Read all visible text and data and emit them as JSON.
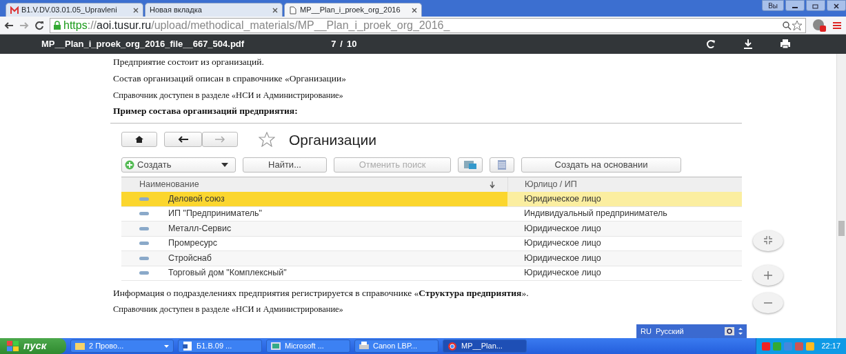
{
  "browser": {
    "tabs": [
      {
        "title": "B1.V.DV.03.01.05_Upravleni",
        "kind": "mail",
        "selected": false
      },
      {
        "title": "Новая вкладка",
        "kind": "blank",
        "selected": false
      },
      {
        "title": "MP__Plan_i_proek_org_2016",
        "kind": "doc",
        "selected": true
      }
    ],
    "user_button": "Вы",
    "address": {
      "scheme": "https",
      "separator": "://",
      "host": "aoi.tusur.ru",
      "path": "/upload/methodical_materials/MP__Plan_i_proek_org_2016_"
    }
  },
  "pdf_toolbar": {
    "file_name": "MP__Plan_i_proek_org_2016_file__667_504.pdf",
    "page": "7",
    "page_separator": "/",
    "page_count": "10"
  },
  "document": {
    "paragraphs_before": [
      {
        "text": "Предприятие состоит из организаций.",
        "kind": "text"
      },
      {
        "text": "Состав организаций описан в справочнике «Организации»",
        "kind": "text"
      },
      {
        "text": "Справочник доступен в разделе «НСИ и Администрирование»",
        "kind": "small"
      },
      {
        "text": "Пример состава организаций предприятия:",
        "kind": "bold"
      }
    ],
    "figure": {
      "title": "Организации",
      "buttons": [
        {
          "label": "Создать",
          "kind": "create",
          "disabled": false
        },
        {
          "label": "Найти...",
          "kind": "plain",
          "disabled": false
        },
        {
          "label": "Отменить поиск",
          "kind": "plain",
          "disabled": true
        },
        {
          "label": "Создать на основании",
          "kind": "plain",
          "disabled": false
        }
      ],
      "columns": [
        "Наименование",
        "Юрлицо / ИП"
      ],
      "rows": [
        {
          "name": "Деловой союз",
          "type": "Юридическое лицо",
          "selected": true
        },
        {
          "name": "ИП \"Предприниматель\"",
          "type": "Индивидуальный предприниматель",
          "selected": false
        },
        {
          "name": "Металл-Сервис",
          "type": "Юридическое лицо",
          "selected": false
        },
        {
          "name": "Промресурс",
          "type": "Юридическое лицо",
          "selected": false
        },
        {
          "name": "Стройснаб",
          "type": "Юридическое лицо",
          "selected": false
        },
        {
          "name": "Торговый дом \"Комплексный\"",
          "type": "Юридическое лицо",
          "selected": false
        }
      ]
    },
    "paragraphs_after": [
      {
        "text": "Информация о подразделениях предприятия регистрируется в справочнике «**Структура предприятия**».",
        "kind": "text"
      },
      {
        "text": "Справочник доступен в разделе «НСИ и Администрирование»",
        "kind": "small"
      }
    ]
  },
  "language_bar": {
    "code": "RU",
    "language": "Русский"
  },
  "taskbar": {
    "start": "пуск",
    "items": [
      {
        "label": "2 Прово...",
        "kind": "folder",
        "selected": false
      },
      {
        "label": "Б1.В.09 ...",
        "kind": "word",
        "selected": false
      },
      {
        "label": "Microsoft ...",
        "kind": "app",
        "selected": false
      },
      {
        "label": "Canon LBP...",
        "kind": "printer",
        "selected": false
      },
      {
        "label": "MP__Plan...",
        "kind": "chrome",
        "selected": true
      }
    ],
    "clock": "22:17"
  }
}
